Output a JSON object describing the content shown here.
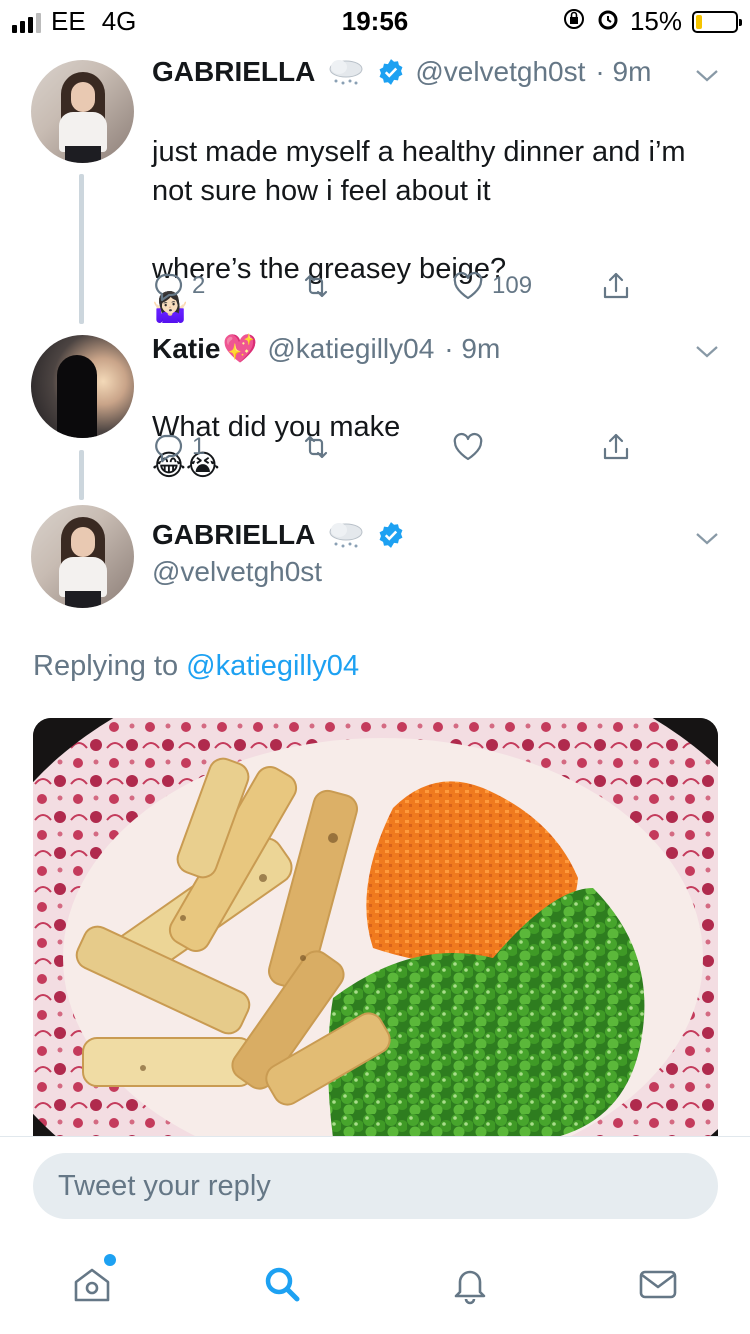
{
  "status_bar": {
    "carrier": "EE",
    "network": "4G",
    "time": "19:56",
    "battery": "15%",
    "battery_level": 0.15
  },
  "tweets": [
    {
      "name": "GABRIELLA",
      "handle": "@velvetgh0st",
      "time": "· 9m",
      "text": "just made myself a healthy dinner and i’m\nnot sure how i feel about it\n\nwhere’s the greasey beige?",
      "emoji": "🤷🏻‍♀️",
      "replies": "2",
      "likes": "109"
    },
    {
      "name": "Katie",
      "name_emoji": "💖",
      "handle": "@katiegilly04",
      "time": "· 9m",
      "text": "What did you make",
      "emoji": "😂😭",
      "replies": "1"
    }
  ],
  "focused_tweet": {
    "name": "GABRIELLA",
    "handle": "@velvetgh0st",
    "replying_prefix": "Replying to",
    "replying_to": "@katiegilly04"
  },
  "reply_bar": {
    "placeholder": "Tweet your reply"
  },
  "tabs": {
    "home_icon": "home-icon",
    "search_icon": "search-icon",
    "notifications_icon": "bell-icon",
    "messages_icon": "mail-icon"
  },
  "colors": {
    "brand": "#1da1f2",
    "secondary_text": "#657786",
    "primary_text": "#14171a"
  }
}
